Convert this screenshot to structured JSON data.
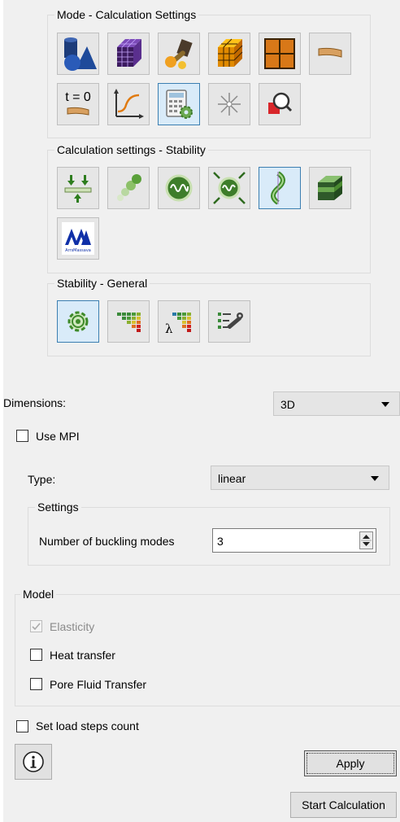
{
  "mode_group": {
    "title": "Mode - Calculation Settings",
    "buttons": [
      {
        "name": "geometry-mode-button",
        "icon": "geometry-shapes-icon",
        "selected": false
      },
      {
        "name": "mesh-mode-button",
        "icon": "mesh-cube-icon",
        "selected": false
      },
      {
        "name": "properties-mode-button",
        "icon": "wrench-tools-icon",
        "selected": false
      },
      {
        "name": "material-mode-button",
        "icon": "gridded-cube-icon",
        "selected": false
      },
      {
        "name": "grid-mode-button",
        "icon": "grid-icon",
        "selected": false
      },
      {
        "name": "beam-mode-button",
        "icon": "beam-icon",
        "selected": false
      },
      {
        "name": "initial-state-button",
        "icon": "initial-state-icon",
        "label": "t = 0",
        "selected": false
      },
      {
        "name": "graph-mode-button",
        "icon": "chart-curve-icon",
        "selected": false
      },
      {
        "name": "calculation-settings-button",
        "icon": "calculator-gear-icon",
        "selected": true
      },
      {
        "name": "results-mode-button",
        "icon": "starburst-icon",
        "selected": false
      },
      {
        "name": "inspect-mode-button",
        "icon": "magnifier-icon",
        "selected": false
      }
    ]
  },
  "analysis_group": {
    "title": "Calculation settings - Stability",
    "buttons": [
      {
        "name": "statics-analysis-button",
        "icon": "load-arrows-icon",
        "selected": false
      },
      {
        "name": "dynamics-analysis-button",
        "icon": "motion-trail-icon",
        "selected": false
      },
      {
        "name": "eigenfrequency-analysis-button",
        "icon": "oscillation-icon",
        "selected": false
      },
      {
        "name": "forced-vibration-button",
        "icon": "oscillation-arrows-icon",
        "selected": false
      },
      {
        "name": "stability-analysis-button",
        "icon": "buckling-icon",
        "selected": true
      },
      {
        "name": "layered-analysis-button",
        "icon": "layered-cube-icon",
        "selected": false
      },
      {
        "name": "arrhythmia-analysis-button",
        "icon": "logo-icon",
        "logo_text": "ArrsMassava",
        "selected": false
      }
    ]
  },
  "stability_group": {
    "title": "Stability - General",
    "buttons": [
      {
        "name": "general-settings-button",
        "icon": "gear-icon",
        "selected": true
      },
      {
        "name": "matrix-settings-button",
        "icon": "matrix-icon",
        "selected": false
      },
      {
        "name": "eigenvalue-settings-button",
        "icon": "matrix-lambda-icon",
        "label": "λ",
        "selected": false
      },
      {
        "name": "solver-settings-button",
        "icon": "list-wrench-icon",
        "selected": false
      }
    ]
  },
  "dimensions": {
    "label": "Dimensions:",
    "value": "3D"
  },
  "use_mpi": {
    "label": "Use MPI",
    "checked": false
  },
  "type": {
    "label": "Type:",
    "value": "linear"
  },
  "settings": {
    "title": "Settings",
    "buckling_label": "Number of buckling modes",
    "buckling_value": "3"
  },
  "model": {
    "title": "Model",
    "elasticity": {
      "label": "Elasticity",
      "checked": true,
      "disabled": true
    },
    "heat_transfer": {
      "label": "Heat transfer",
      "checked": false
    },
    "pore_fluid": {
      "label": "Pore Fluid Transfer",
      "checked": false
    }
  },
  "load_steps": {
    "label": "Set load steps count",
    "checked": false
  },
  "info_icon": "info-icon",
  "buttons": {
    "apply": "Apply",
    "start": "Start Calculation"
  },
  "colors": {
    "selected_border": "#3c7fb1",
    "selected_fill": "#d9ebf9",
    "panel": "#f0f0f0"
  }
}
